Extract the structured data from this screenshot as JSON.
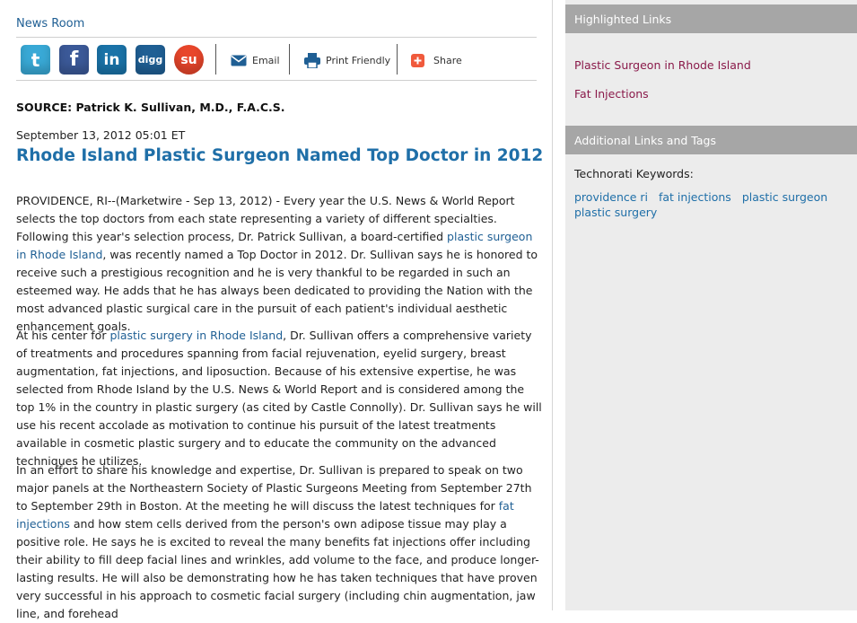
{
  "header": {
    "newsroom": "News Room"
  },
  "toolbar": {
    "social": [
      {
        "name": "twitter",
        "glyph": "t",
        "color": "#39a9d6"
      },
      {
        "name": "facebook",
        "glyph": "f",
        "color": "#3b5998"
      },
      {
        "name": "linkedin",
        "glyph": "in",
        "color": "#1a73a8"
      },
      {
        "name": "digg",
        "glyph": "digg",
        "color": "#1f5f94"
      },
      {
        "name": "stumbleupon",
        "glyph": "su",
        "color": "#e8462b"
      }
    ],
    "email_label": "Email",
    "print_label": "Print Friendly",
    "share_label": "Share"
  },
  "article": {
    "source": "SOURCE: Patrick K. Sullivan, M.D., F.A.C.S.",
    "date": "September 13, 2012 05:01 ET",
    "headline": "Rhode Island Plastic Surgeon Named Top Doctor in 2012",
    "p1": {
      "a": "PROVIDENCE, RI--(Marketwire - Sep 13, 2012) - Every year the U.S. News & World Report selects the top doctors from each state representing a variety of different specialties. Following this year's selection process, Dr. Patrick Sullivan, a board-certified ",
      "link": "plastic surgeon in Rhode Island",
      "b": ", was recently named a Top Doctor in 2012. Dr. Sullivan says he is honored to receive such a prestigious recognition and he is very thankful to be regarded in such an esteemed way. He adds that he has always been dedicated to providing the Nation with the most advanced plastic surgical care in the pursuit of each patient's individual aesthetic enhancement goals."
    },
    "p2": {
      "a": "At his center for ",
      "link": "plastic surgery in Rhode Island",
      "b": ", Dr. Sullivan offers a comprehensive variety of treatments and procedures spanning from facial rejuvenation, eyelid surgery, breast augmentation, fat injections, and liposuction. Because of his extensive expertise, he was selected from Rhode Island by the U.S. News & World Report and is considered among the top 1% in the country in plastic surgery (as cited by Castle Connolly). Dr. Sullivan says he will use his recent accolade as motivation to continue his pursuit of the latest treatments available in cosmetic plastic surgery and to educate the community on the advanced techniques he utilizes."
    },
    "p3": {
      "a": "In an effort to share his knowledge and expertise, Dr. Sullivan is prepared to speak on two major panels at the Northeastern Society of Plastic Surgeons Meeting from September 27th to September 29th in Boston. At the meeting he will discuss the latest techniques for ",
      "link": "fat injections",
      "b": " and how stem cells derived from the person's own adipose tissue may play a positive role. He says he is excited to reveal the many benefits fat injections offer including their ability to fill deep facial lines and wrinkles, add volume to the face, and produce longer-lasting results. He will also be demonstrating how he has taken techniques that have proven very successful in his approach to cosmetic facial surgery (including chin augmentation, jaw line, and forehead"
    }
  },
  "sidebar": {
    "highlighted_title": "Highlighted Links",
    "highlighted_links": [
      "Plastic Surgeon in Rhode Island",
      "Fat Injections"
    ],
    "additional_title": "Additional Links and Tags",
    "technorati_label": "Technorati Keywords:",
    "tags": [
      "providence ri",
      "fat injections",
      "plastic surgeon",
      "plastic surgery"
    ]
  }
}
